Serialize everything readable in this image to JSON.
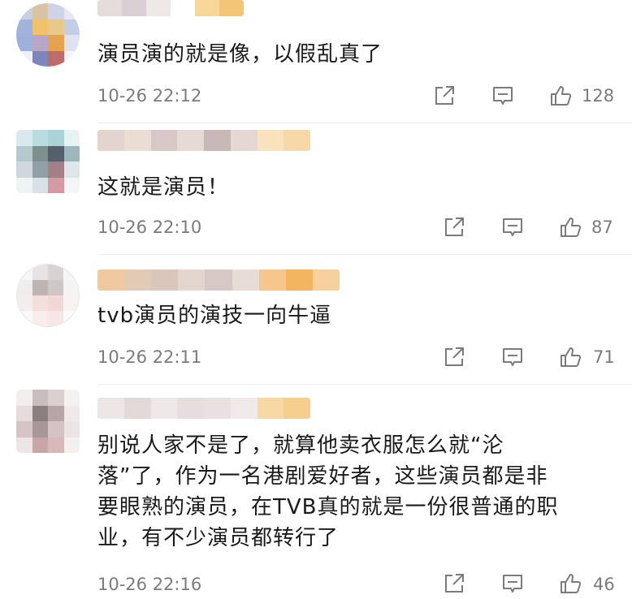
{
  "comments": [
    {
      "text": "演员演的就是像，以假乱真了",
      "time": "10-26 22:12",
      "likes": "128"
    },
    {
      "text": "这就是演员！",
      "time": "10-26 22:10",
      "likes": "87"
    },
    {
      "text": "tvb演员的演技一向牛逼",
      "time": "10-26 22:11",
      "likes": "71"
    },
    {
      "text": "别说人家不是了，就算他卖衣服怎么就“沦\n落”了，作为一名港剧爱好者，这些演员都是非\n要眼熟的演员，在TVB真的就是一份很普通的职\n业，有不少演员都转行了",
      "time": "10-26 22:16",
      "likes": "46"
    }
  ],
  "icons": {
    "share": "share-icon",
    "reply": "comment-icon",
    "like": "thumbs-up-icon"
  },
  "colors": {
    "text": "#1a1a1a",
    "meta": "#7b7b7b",
    "blur_accent": "#f5b24a"
  }
}
